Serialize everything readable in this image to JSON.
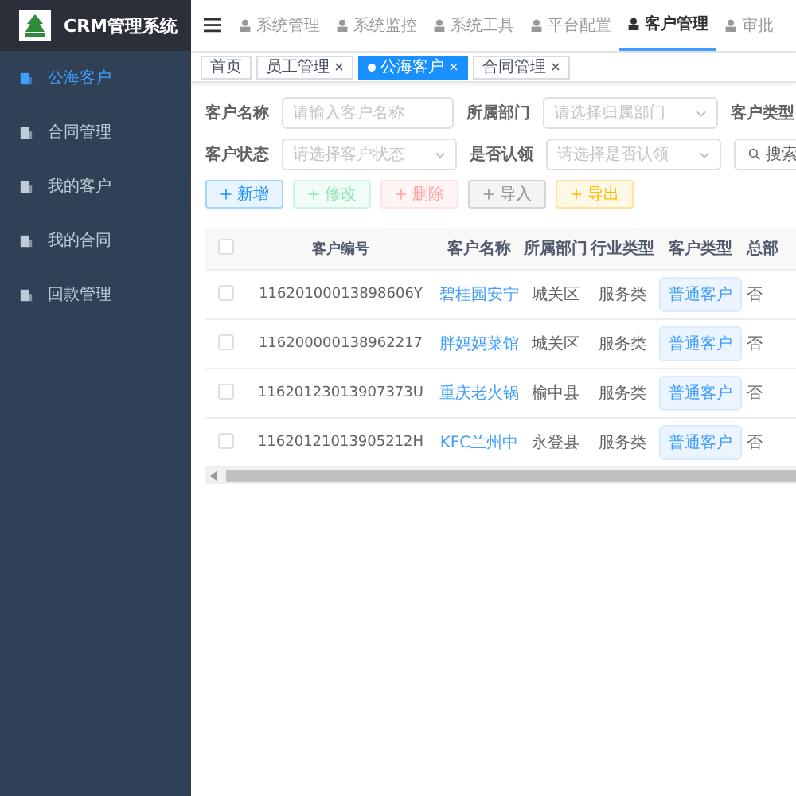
{
  "app": {
    "title": "CRM管理系统"
  },
  "top_nav": [
    {
      "label": "系统管理",
      "selected": false
    },
    {
      "label": "系统监控",
      "selected": false
    },
    {
      "label": "系统工具",
      "selected": false
    },
    {
      "label": "平台配置",
      "selected": false
    },
    {
      "label": "客户管理",
      "selected": true
    },
    {
      "label": "审批",
      "selected": false
    }
  ],
  "sidebar": {
    "items": [
      {
        "label": "公海客户",
        "selected": true
      },
      {
        "label": "合同管理",
        "selected": false
      },
      {
        "label": "我的客户",
        "selected": false
      },
      {
        "label": "我的合同",
        "selected": false
      },
      {
        "label": "回款管理",
        "selected": false
      }
    ]
  },
  "tabs": [
    {
      "label": "首页",
      "selected": false,
      "closable": false
    },
    {
      "label": "员工管理",
      "selected": false,
      "closable": true
    },
    {
      "label": "公海客户",
      "selected": true,
      "closable": true
    },
    {
      "label": "合同管理",
      "selected": false,
      "closable": true
    }
  ],
  "filters": [
    {
      "label": "客户名称",
      "placeholder": "请输入客户名称",
      "kind": "input"
    },
    {
      "label": "所属部门",
      "placeholder": "请选择归属部门",
      "kind": "select"
    },
    {
      "label": "客户类型",
      "kind": "cut"
    },
    {
      "label": "客户状态",
      "placeholder": "请选择客户状态",
      "kind": "select"
    },
    {
      "label": "是否认领",
      "placeholder": "请选择是否认领",
      "kind": "select"
    }
  ],
  "search_button": "搜索",
  "actions": [
    {
      "label": "新增",
      "kind": "add",
      "disabled": false
    },
    {
      "label": "修改",
      "kind": "edit",
      "disabled": true
    },
    {
      "label": "删除",
      "kind": "delete",
      "disabled": true
    },
    {
      "label": "导入",
      "kind": "import",
      "disabled": false
    },
    {
      "label": "导出",
      "kind": "export",
      "disabled": false
    }
  ],
  "table": {
    "all_checked": false,
    "columns": [
      "客户编号",
      "客户名称",
      "所属部门",
      "行业类型",
      "客户类型",
      "总部"
    ],
    "rows": [
      {
        "checked": false,
        "cells": [
          "11620100013898606Y",
          "碧桂园安宁",
          "城关区",
          "服务类",
          "普通客户",
          "否"
        ]
      },
      {
        "checked": false,
        "cells": [
          "116200000138962217",
          "胖妈妈菜馆",
          "城关区",
          "服务类",
          "普通客户",
          "否"
        ]
      },
      {
        "checked": false,
        "cells": [
          "11620123013907373U",
          "重庆老火锅",
          "榆中县",
          "服务类",
          "普通客户",
          "否"
        ]
      },
      {
        "checked": false,
        "cells": [
          "11620121013905212H",
          "KFC兰州中",
          "永登县",
          "服务类",
          "普通客户",
          "否"
        ]
      }
    ]
  }
}
